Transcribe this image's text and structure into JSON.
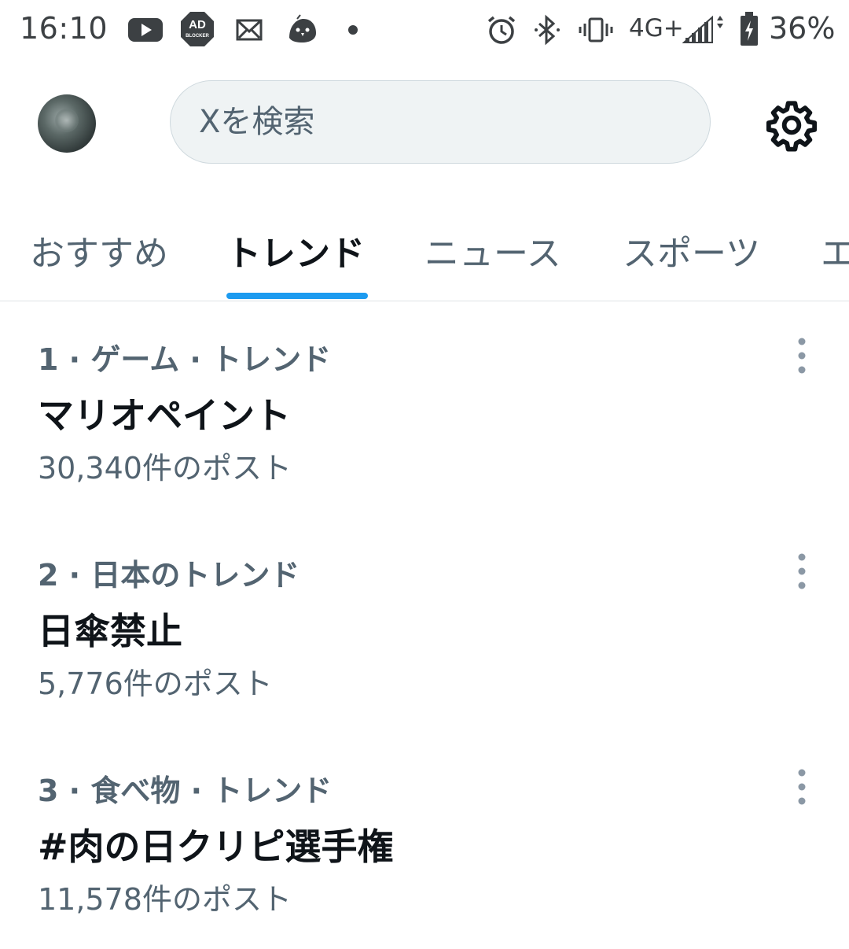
{
  "status_bar": {
    "time": "16:10",
    "battery": "36%",
    "network": "4G+",
    "icons": [
      "youtube-icon",
      "ad-blocker-icon",
      "mail-icon",
      "bird-icon",
      "dot-icon",
      "alarm-icon",
      "bluetooth-icon",
      "vibrate-icon",
      "network-4g-icon",
      "signal-icon",
      "battery-icon"
    ],
    "ad_blocker_line1": "AD",
    "ad_blocker_line2": "BLOCKER"
  },
  "header": {
    "search_placeholder": "Xを検索",
    "avatar_icon": "avatar",
    "settings_icon": "gear-icon"
  },
  "tabs": [
    {
      "label": "おすすめ",
      "active": false
    },
    {
      "label": "トレンド",
      "active": true
    },
    {
      "label": "ニュース",
      "active": false
    },
    {
      "label": "スポーツ",
      "active": false
    },
    {
      "label": "エ",
      "active": false
    }
  ],
  "trends": [
    {
      "meta": "1 · ゲーム · トレンド",
      "title": "マリオペイント",
      "count": "30,340件のポスト"
    },
    {
      "meta": "2 · 日本のトレンド",
      "title": "日傘禁止",
      "count": "5,776件のポスト"
    },
    {
      "meta": "3 · 食べ物 · トレンド",
      "title": "#肉の日クリピ選手権",
      "count": "11,578件のポスト"
    }
  ],
  "colors": {
    "accent": "#1d9bf0",
    "text_primary": "#0f1419",
    "text_secondary": "#536471",
    "search_bg": "#eff3f4"
  }
}
